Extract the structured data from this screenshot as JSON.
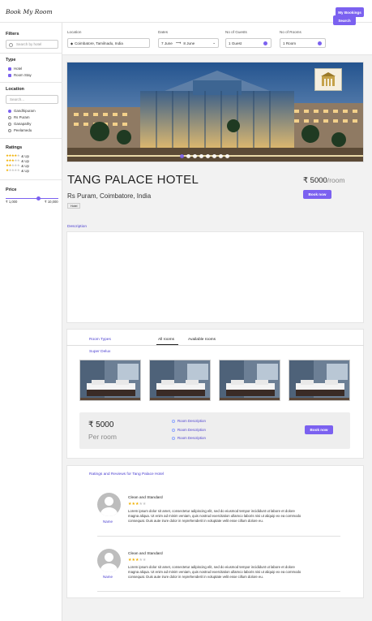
{
  "app": {
    "logo": "Book My Room",
    "my_bookings": "My Bookings"
  },
  "sidebar": {
    "filters_title": "Filters",
    "hotel_search_placeholder": "Search by hotel",
    "type_title": "Type",
    "types": [
      {
        "label": "Hotel",
        "checked": true
      },
      {
        "label": "Room Stay",
        "checked": true
      }
    ],
    "location_title": "Location",
    "location_search_placeholder": "Search...",
    "locations": [
      {
        "label": "Gandhipuram",
        "checked": true
      },
      {
        "label": "Rs Puram",
        "checked": false
      },
      {
        "label": "Ganapathy",
        "checked": false
      },
      {
        "label": "Peelamedu",
        "checked": false
      }
    ],
    "ratings_title": "Ratings",
    "ratings": [
      {
        "stars": 4,
        "label": "& Up"
      },
      {
        "stars": 3,
        "label": "& Up"
      },
      {
        "stars": 2,
        "label": "& Up"
      },
      {
        "stars": 1,
        "label": "& Up"
      }
    ],
    "price_title": "Price",
    "price_min": "₹ 1,000",
    "price_max": "₹ 10,000",
    "price_level": 0.62
  },
  "search": {
    "location_label": "Location",
    "location_value": "Coimbatore, Tamilnadu, India",
    "dates_label": "Dates",
    "date_from": "7 June",
    "date_to": "8 June",
    "guests_label": "No of Guests",
    "guests_value": "1 Guest",
    "rooms_label": "No of Rooms",
    "rooms_value": "1 Room",
    "search_button": "Search"
  },
  "hotel": {
    "name": "TANG PALACE HOTEL",
    "address": "Rs Puram, Coimbatore, India",
    "tag": "Hotel",
    "price": "₹ 5000",
    "per": "/room",
    "book_now": "Book now",
    "carousel_dots": 8,
    "carousel_active": 0,
    "description_label": "Description"
  },
  "rooms": {
    "room_types_label": "Room Types",
    "tabs": [
      "All rooms",
      "Available rooms"
    ],
    "active_tab": "All rooms",
    "room_name": "Super Delux",
    "price": "₹ 5000",
    "per": "Per room",
    "descriptions": [
      "Room Description",
      "Room Description",
      "Room Description"
    ],
    "book_now": "Book now"
  },
  "reviews": {
    "title": "Ratings and Reviews for Tang Palace Hotel",
    "items": [
      {
        "name": "Name",
        "title": "Clean and Standard",
        "stars": 3,
        "text": "Lorem ipsum dolor sit amet, consectetur adipiscing elit, sed do eiusmod tempor incididunt ut labore et dolore magna aliqua. Ut enim ad minim veniam, quis nostrud exercitation ullamco laboris nisi ut aliquip ex ea commodo consequat. Duis aute irure dolor in reprehenderit in voluptate velit esse cillum dolore eu."
      },
      {
        "name": "Name",
        "title": "Clean and Standard",
        "stars": 3,
        "text": "Lorem ipsum dolor sit amet, consectetur adipiscing elit, sed do eiusmod tempor incididunt ut labore et dolore magna aliqua. Ut enim ad minim veniam, quis nostrud exercitation ullamco laboris nisi ut aliquip ex ea commodo consequat. Duis aute irure dolor in reprehenderit in voluptate velit esse cillum dolore eu."
      }
    ]
  },
  "colors": {
    "accent": "#7b61f0",
    "link": "#4b3fd0",
    "star": "#f0b000"
  }
}
